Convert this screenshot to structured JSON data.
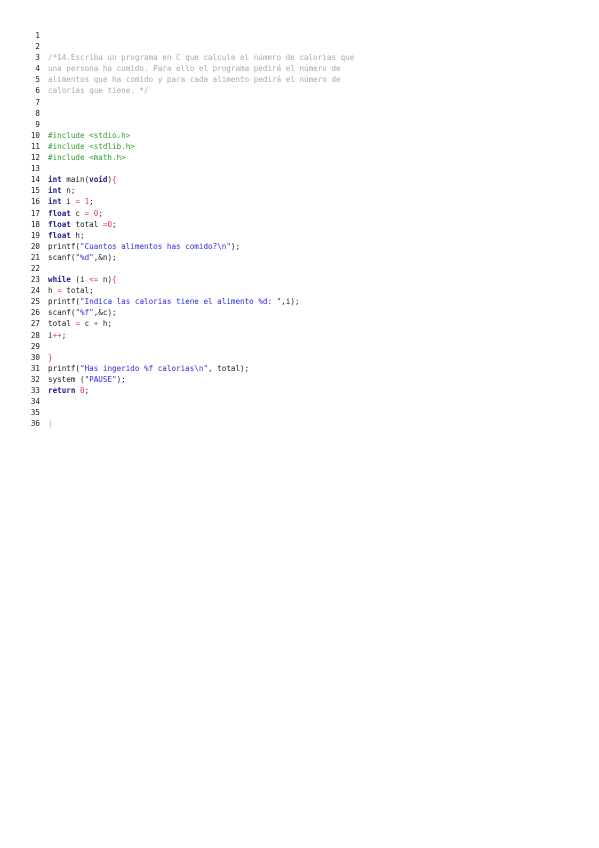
{
  "colors": {
    "comment": "#a9a9a9",
    "preproc": "#2e9e2e",
    "keyword": "#1a1a8c",
    "string": "#2a2ad6",
    "number": "#e0306a",
    "plain": "#1a1a1a"
  },
  "lines": [
    {
      "n": "1",
      "tokens": []
    },
    {
      "n": "2",
      "tokens": []
    },
    {
      "n": "3",
      "tokens": [
        {
          "t": "comment",
          "v": "/*14.Escriba un programa en C que calcule el número de calorias que"
        }
      ]
    },
    {
      "n": "4",
      "tokens": [
        {
          "t": "comment",
          "v": "una persona ha comido. Para ello el programa pedirá el número de"
        }
      ]
    },
    {
      "n": "5",
      "tokens": [
        {
          "t": "comment",
          "v": "alimentos que ha comido y para cada alimento pedirá el número de"
        }
      ]
    },
    {
      "n": "6",
      "tokens": [
        {
          "t": "comment",
          "v": "calorias que tiene. */"
        }
      ]
    },
    {
      "n": "7",
      "tokens": []
    },
    {
      "n": "8",
      "tokens": []
    },
    {
      "n": "9",
      "tokens": []
    },
    {
      "n": "10",
      "tokens": [
        {
          "t": "preproc",
          "v": "#include <stdio.h>"
        }
      ]
    },
    {
      "n": "11",
      "tokens": [
        {
          "t": "preproc",
          "v": "#include <stdlib.h>"
        }
      ]
    },
    {
      "n": "12",
      "tokens": [
        {
          "t": "preproc",
          "v": "#include <math.h>"
        }
      ]
    },
    {
      "n": "13",
      "tokens": []
    },
    {
      "n": "14",
      "tokens": [
        {
          "t": "keyword",
          "v": "int"
        },
        {
          "t": "plain",
          "v": " main("
        },
        {
          "t": "keyword",
          "v": "void"
        },
        {
          "t": "plain",
          "v": ")"
        },
        {
          "t": "op",
          "v": "{"
        }
      ]
    },
    {
      "n": "15",
      "tokens": [
        {
          "t": "keyword",
          "v": "int"
        },
        {
          "t": "plain",
          "v": " n;"
        }
      ]
    },
    {
      "n": "16",
      "tokens": [
        {
          "t": "keyword",
          "v": "int"
        },
        {
          "t": "plain",
          "v": " i "
        },
        {
          "t": "op",
          "v": "="
        },
        {
          "t": "plain",
          "v": " "
        },
        {
          "t": "number",
          "v": "1"
        },
        {
          "t": "plain",
          "v": ";"
        }
      ]
    },
    {
      "n": "17",
      "tokens": [
        {
          "t": "keyword",
          "v": "float"
        },
        {
          "t": "plain",
          "v": " c "
        },
        {
          "t": "op",
          "v": "="
        },
        {
          "t": "plain",
          "v": " "
        },
        {
          "t": "number",
          "v": "0"
        },
        {
          "t": "plain",
          "v": ";"
        }
      ]
    },
    {
      "n": "18",
      "tokens": [
        {
          "t": "keyword",
          "v": "float"
        },
        {
          "t": "plain",
          "v": " total "
        },
        {
          "t": "op",
          "v": "="
        },
        {
          "t": "number",
          "v": "0"
        },
        {
          "t": "plain",
          "v": ";"
        }
      ]
    },
    {
      "n": "19",
      "tokens": [
        {
          "t": "keyword",
          "v": "float"
        },
        {
          "t": "plain",
          "v": " h;"
        }
      ]
    },
    {
      "n": "20",
      "tokens": [
        {
          "t": "plain",
          "v": "printf("
        },
        {
          "t": "string",
          "v": "\"Cuantos alimentos has comido?\\n\""
        },
        {
          "t": "plain",
          "v": ");"
        }
      ]
    },
    {
      "n": "21",
      "tokens": [
        {
          "t": "plain",
          "v": "scanf("
        },
        {
          "t": "string",
          "v": "\"%d\""
        },
        {
          "t": "plain",
          "v": ",&n);"
        }
      ]
    },
    {
      "n": "22",
      "tokens": []
    },
    {
      "n": "23",
      "tokens": [
        {
          "t": "keyword",
          "v": "while"
        },
        {
          "t": "plain",
          "v": " (i "
        },
        {
          "t": "op",
          "v": "<="
        },
        {
          "t": "plain",
          "v": " n)"
        },
        {
          "t": "op",
          "v": "{"
        }
      ]
    },
    {
      "n": "24",
      "tokens": [
        {
          "t": "plain",
          "v": "h "
        },
        {
          "t": "op",
          "v": "="
        },
        {
          "t": "plain",
          "v": " total;"
        }
      ]
    },
    {
      "n": "25",
      "tokens": [
        {
          "t": "plain",
          "v": "printf("
        },
        {
          "t": "string",
          "v": "\"Indica las calorias tiene el alimento %d: \""
        },
        {
          "t": "plain",
          "v": ",i);"
        }
      ]
    },
    {
      "n": "26",
      "tokens": [
        {
          "t": "plain",
          "v": "scanf("
        },
        {
          "t": "string",
          "v": "\"%f\""
        },
        {
          "t": "plain",
          "v": ",&c);"
        }
      ]
    },
    {
      "n": "27",
      "tokens": [
        {
          "t": "plain",
          "v": "total "
        },
        {
          "t": "op",
          "v": "="
        },
        {
          "t": "plain",
          "v": " c "
        },
        {
          "t": "op",
          "v": "+"
        },
        {
          "t": "plain",
          "v": " h;"
        }
      ]
    },
    {
      "n": "28",
      "tokens": [
        {
          "t": "plain",
          "v": "i"
        },
        {
          "t": "op",
          "v": "++"
        },
        {
          "t": "plain",
          "v": ";"
        }
      ]
    },
    {
      "n": "29",
      "tokens": []
    },
    {
      "n": "30",
      "tokens": [
        {
          "t": "op",
          "v": "}"
        }
      ]
    },
    {
      "n": "31",
      "tokens": [
        {
          "t": "plain",
          "v": "printf("
        },
        {
          "t": "string",
          "v": "\"Has ingerido %f calorias\\n\""
        },
        {
          "t": "plain",
          "v": ", total);"
        }
      ]
    },
    {
      "n": "32",
      "tokens": [
        {
          "t": "plain",
          "v": "system ("
        },
        {
          "t": "string",
          "v": "\"PAUSE\""
        },
        {
          "t": "plain",
          "v": ");"
        }
      ]
    },
    {
      "n": "33",
      "tokens": [
        {
          "t": "keyword",
          "v": "return"
        },
        {
          "t": "plain",
          "v": " "
        },
        {
          "t": "number",
          "v": "0"
        },
        {
          "t": "plain",
          "v": ";"
        }
      ]
    },
    {
      "n": "34",
      "tokens": []
    },
    {
      "n": "35",
      "tokens": []
    },
    {
      "n": "36",
      "tokens": [
        {
          "t": "cursor",
          "v": "|"
        }
      ]
    }
  ]
}
